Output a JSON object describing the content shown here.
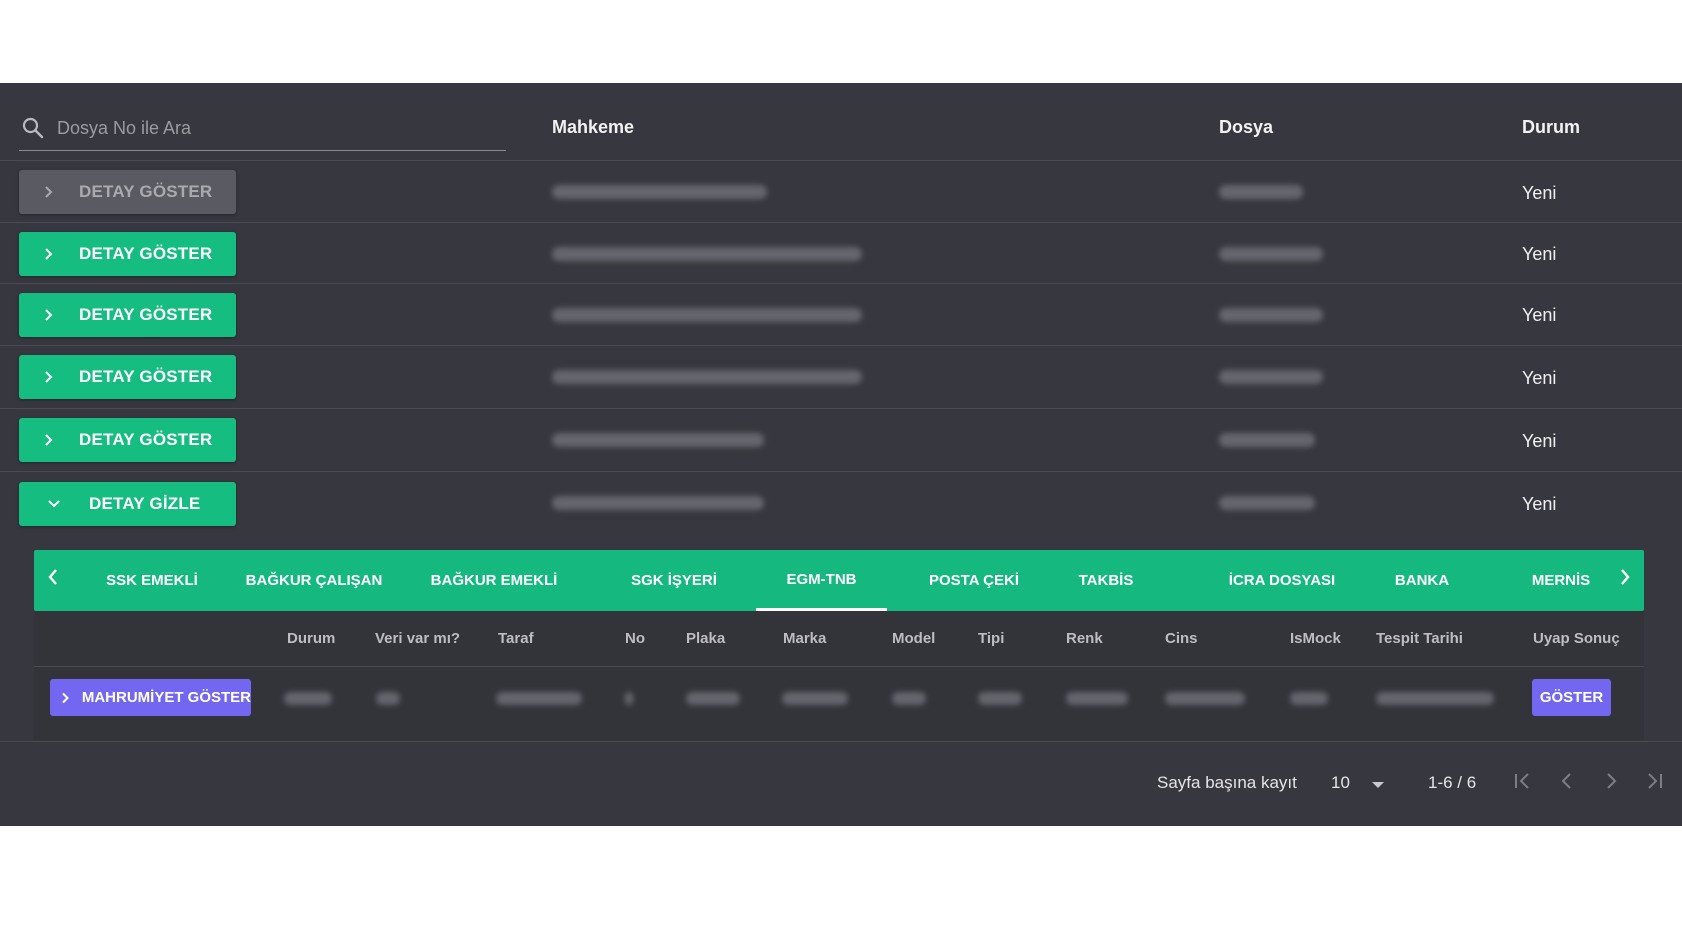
{
  "search": {
    "placeholder": "Dosya No ile Ara",
    "icon": "search-icon"
  },
  "table": {
    "columns": [
      "Mahkeme",
      "Dosya",
      "Durum"
    ],
    "rows": [
      {
        "action": "DETAY GÖSTER",
        "state": "disabled",
        "durum": "Yeni"
      },
      {
        "action": "DETAY GÖSTER",
        "state": "enabled",
        "durum": "Yeni"
      },
      {
        "action": "DETAY GÖSTER",
        "state": "enabled",
        "durum": "Yeni"
      },
      {
        "action": "DETAY GÖSTER",
        "state": "enabled",
        "durum": "Yeni"
      },
      {
        "action": "DETAY GÖSTER",
        "state": "enabled",
        "durum": "Yeni"
      },
      {
        "action": "DETAY GİZLE",
        "state": "expanded",
        "durum": "Yeni"
      }
    ]
  },
  "detail": {
    "tabs": [
      "SSK EMEKLİ",
      "BAĞKUR ÇALIŞAN",
      "BAĞKUR EMEKLİ",
      "SGK İŞYERİ",
      "EGM-TNB",
      "POSTA ÇEKİ",
      "TAKBİS",
      "İCRA DOSYASI",
      "BANKA",
      "MERNİS"
    ],
    "active_tab": "EGM-TNB",
    "columns": [
      "Durum",
      "Veri var mı?",
      "Taraf",
      "No",
      "Plaka",
      "Marka",
      "Model",
      "Tipi",
      "Renk",
      "Cins",
      "IsMock",
      "Tespit Tarihi",
      "Uyap Sonuç"
    ],
    "row_action": "MAHRUMİYET GÖSTER",
    "result_action": "GÖSTER"
  },
  "pagination": {
    "per_page_label": "Sayfa başına kayıt",
    "per_page_value": "10",
    "range": "1-6 / 6"
  },
  "colors": {
    "panel": "#37373f",
    "accent_green": "#16bd80",
    "accent_purple": "#7366f0"
  }
}
